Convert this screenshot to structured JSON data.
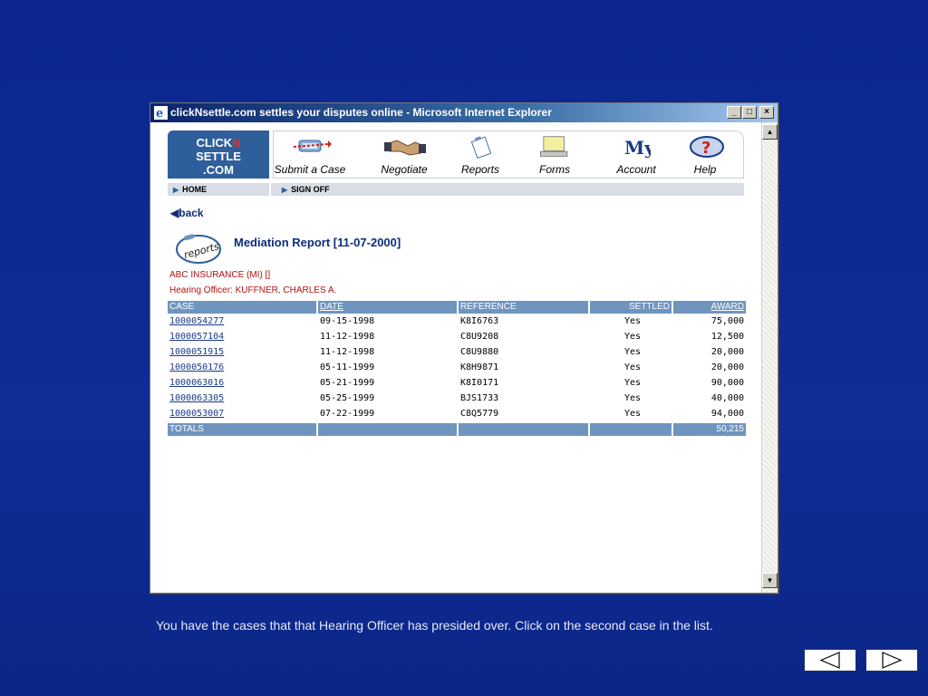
{
  "window": {
    "title": "clickNsettle.com settles your disputes online - Microsoft Internet Explorer",
    "buttons": {
      "minimize": "_",
      "maximize": "□",
      "close": "×"
    }
  },
  "logo": {
    "line1_a": "CLICK",
    "line1_b": "N",
    "line2": "SETTLE",
    "line3": ".COM"
  },
  "nav": [
    {
      "label": "Submit a Case",
      "icon": "submit-icon"
    },
    {
      "label": "Negotiate",
      "icon": "handshake-icon"
    },
    {
      "label": "Reports",
      "icon": "reports-icon"
    },
    {
      "label": "Forms",
      "icon": "forms-icon"
    },
    {
      "label": "Account",
      "icon": "my-account-icon",
      "icon_text": "My"
    },
    {
      "label": "Help",
      "icon": "help-icon",
      "icon_text": "?"
    }
  ],
  "subnav": {
    "home": "HOME",
    "sign_off": "SIGN OFF"
  },
  "back_label": "back",
  "report": {
    "icon_text": "reports",
    "title": "Mediation Report [11-07-2000]",
    "company": "ABC INSURANCE (MI) []",
    "officer": "Hearing Officer: KUFFNER, CHARLES A."
  },
  "table": {
    "headers": {
      "case": "CASE",
      "date": "DATE",
      "reference": "REFERENCE",
      "settled": "SETTLED",
      "award": "AWARD"
    },
    "rows": [
      {
        "case": "1000054277",
        "date": "09-15-1998",
        "reference": "K8I6763",
        "settled": "Yes",
        "award": "75,000"
      },
      {
        "case": "1000057104",
        "date": "11-12-1998",
        "reference": "C8U9208",
        "settled": "Yes",
        "award": "12,500"
      },
      {
        "case": "1000051915",
        "date": "11-12-1998",
        "reference": "C8U9880",
        "settled": "Yes",
        "award": "20,000"
      },
      {
        "case": "1000050176",
        "date": "05-11-1999",
        "reference": "K8H9871",
        "settled": "Yes",
        "award": "20,000"
      },
      {
        "case": "1000063016",
        "date": "05-21-1999",
        "reference": "K8I0171",
        "settled": "Yes",
        "award": "90,000"
      },
      {
        "case": "1000063305",
        "date": "05-25-1999",
        "reference": "BJS1733",
        "settled": "Yes",
        "award": "40,000"
      },
      {
        "case": "1000053007",
        "date": "07-22-1999",
        "reference": "C8Q5779",
        "settled": "Yes",
        "award": "94,000"
      }
    ],
    "totals_label": "TOTALS",
    "totals_award": "50,215"
  },
  "caption": "You have the cases that that Hearing Officer has presided over.  Click on the second case in the list.",
  "colors": {
    "slide_bg": "#0d2a8c",
    "header_row": "#6f95bf",
    "accent_red": "#b01010",
    "link": "#1a3a8a"
  }
}
